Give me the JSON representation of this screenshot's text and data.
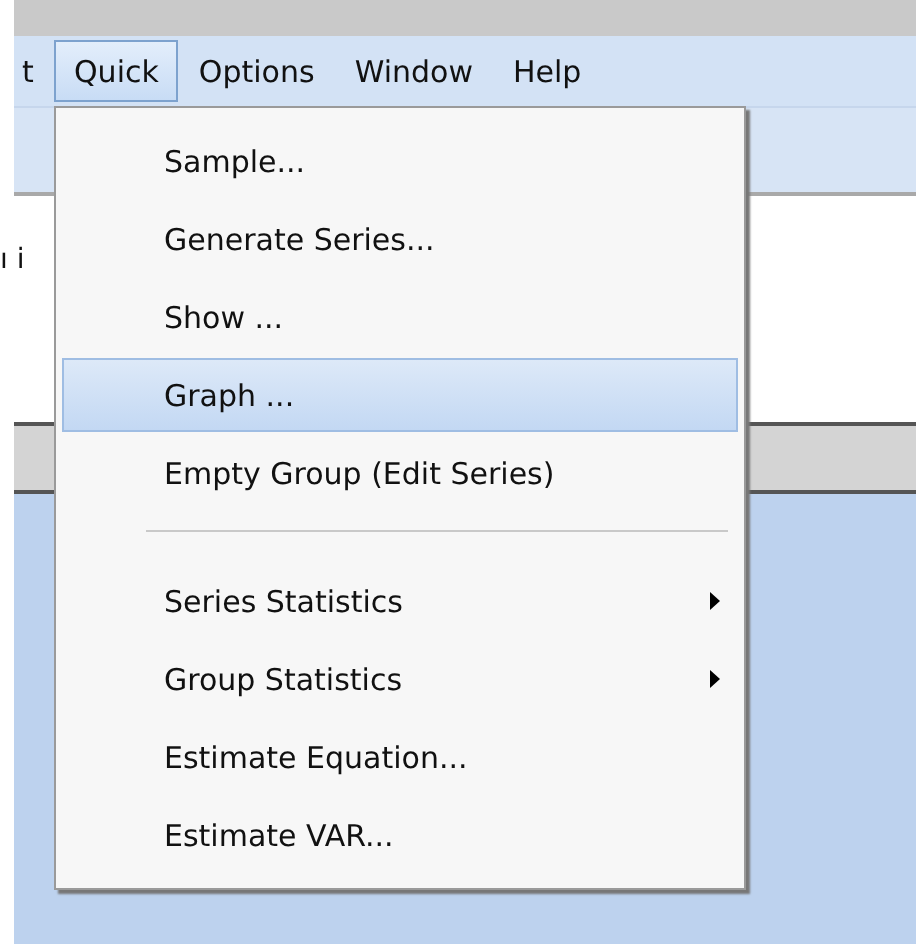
{
  "menu_bar": {
    "items": [
      {
        "label": "t",
        "selected": false
      },
      {
        "label": "Quick",
        "selected": true
      },
      {
        "label": "Options",
        "selected": false
      },
      {
        "label": "Window",
        "selected": false
      },
      {
        "label": "Help",
        "selected": false
      }
    ]
  },
  "workspace": {
    "text": "ı i"
  },
  "dropdown": {
    "items": [
      {
        "kind": "item",
        "label": "Sample...",
        "selected": false,
        "submenu": false
      },
      {
        "kind": "item",
        "label": "Generate Series...",
        "selected": false,
        "submenu": false
      },
      {
        "kind": "item",
        "label": "Show ...",
        "selected": false,
        "submenu": false
      },
      {
        "kind": "item",
        "label": "Graph ...",
        "selected": true,
        "submenu": false
      },
      {
        "kind": "item",
        "label": "Empty Group (Edit Series)",
        "selected": false,
        "submenu": false
      },
      {
        "kind": "separator"
      },
      {
        "kind": "item",
        "label": "Series Statistics",
        "selected": false,
        "submenu": true
      },
      {
        "kind": "item",
        "label": "Group Statistics",
        "selected": false,
        "submenu": true
      },
      {
        "kind": "item",
        "label": "Estimate Equation...",
        "selected": false,
        "submenu": false
      },
      {
        "kind": "item",
        "label": "Estimate VAR...",
        "selected": false,
        "submenu": false
      }
    ]
  }
}
